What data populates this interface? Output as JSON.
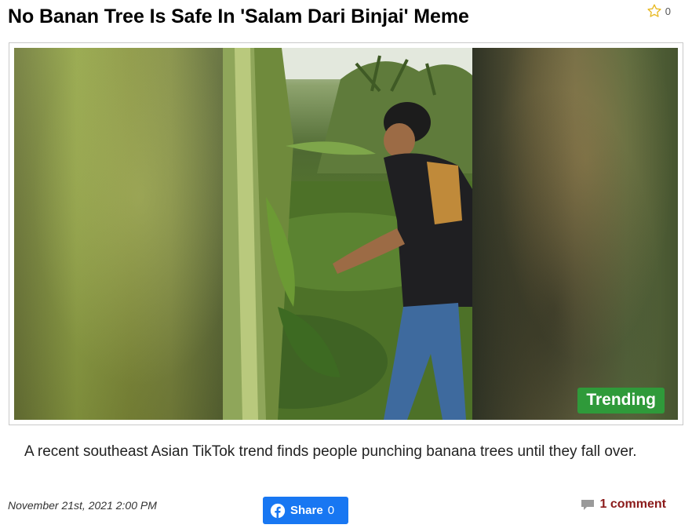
{
  "article": {
    "title": "No Banan Tree Is Safe In 'Salam Dari Binjai' Meme",
    "favorite_count": "0",
    "badge": "Trending",
    "caption": "A recent southeast Asian TikTok trend finds people punching banana trees until they fall over.",
    "date": "November 21st, 2021 2:00 PM",
    "share_label": "Share",
    "share_count": "0",
    "comments_label": "1 comment"
  },
  "colors": {
    "share_blue": "#1877f2",
    "trending_green": "#2f9a3a",
    "comment_red": "#8b1a1a",
    "star_yellow": "#e8b923"
  },
  "icons": {
    "favorite": "star-outline-icon",
    "share": "facebook-icon",
    "comments": "speech-bubble-icon"
  }
}
